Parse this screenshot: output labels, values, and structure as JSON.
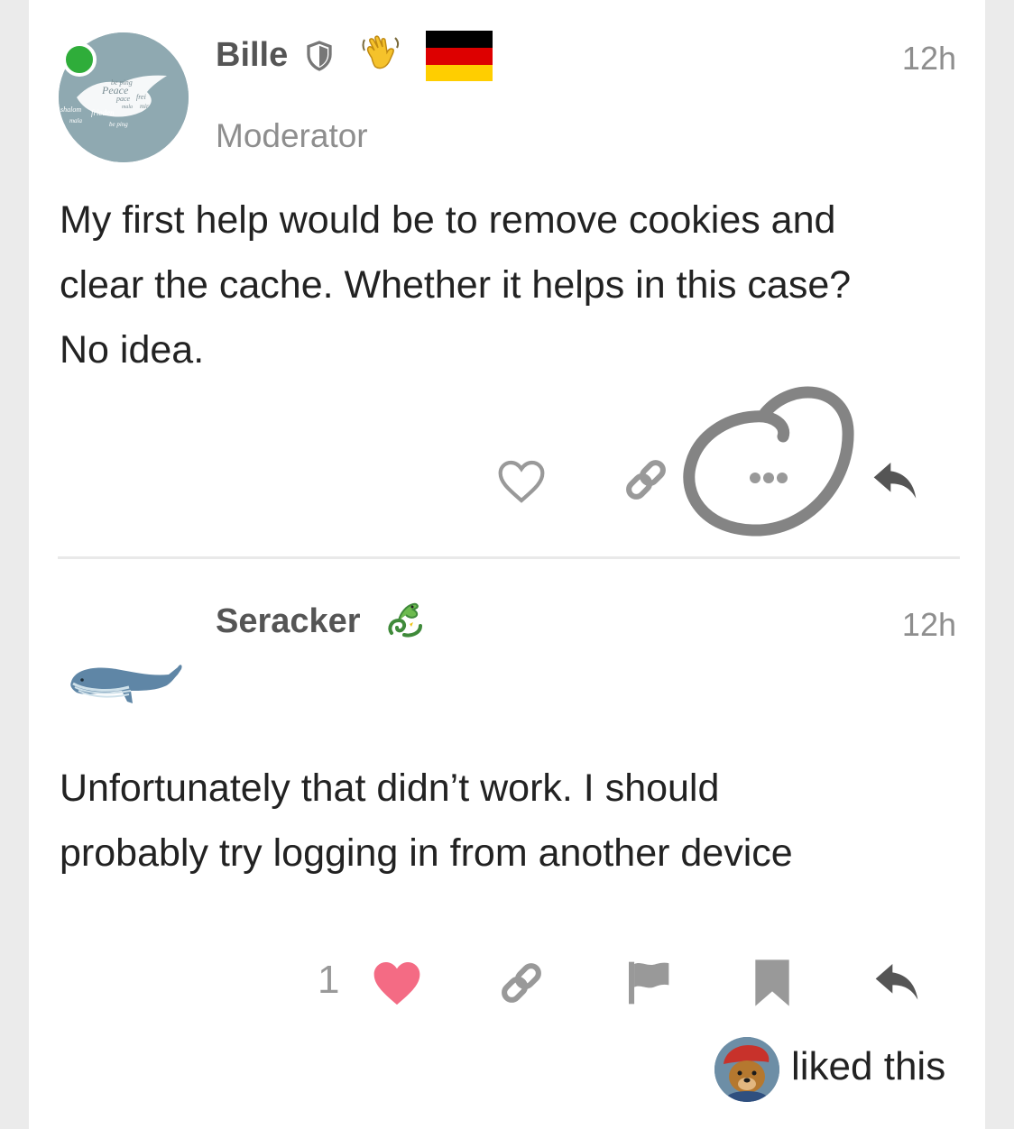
{
  "posts": [
    {
      "username": "Bille",
      "title": "Moderator",
      "time": "12h",
      "body_lines": [
        "My first help would be to remove cookies and",
        "clear the cache. Whether it helps in this case?",
        "No idea."
      ],
      "avatar_text": [
        "be ping",
        "Peace",
        "pace",
        "frei",
        "mala",
        "mir",
        "shalom",
        "frieden",
        "mala",
        "be ping"
      ]
    },
    {
      "username": "Seracker",
      "time": "12h",
      "body_lines": [
        "Unfortunately that didn’t work. I should",
        "probably try logging in from another device"
      ],
      "like_count": "1",
      "liked_text": "liked this"
    }
  ],
  "icons": {
    "moderator_badge": "shield-icon",
    "user_flair": "waving-hand-icon",
    "country_flag": "germany-flag-icon",
    "seracker_flair": "dragon-icon",
    "like": "heart-icon",
    "link": "link-icon",
    "more": "ellipsis-icon",
    "reply": "reply-icon",
    "flag": "flag-icon",
    "bookmark": "bookmark-icon"
  },
  "colors": {
    "online": "#2fad3a",
    "liked_heart": "#f46b84",
    "icon_gray": "#999999",
    "annotation_circle": "#7a7a7a",
    "flag_black": "#000000",
    "flag_red": "#dd0000",
    "flag_gold": "#ffce00"
  }
}
